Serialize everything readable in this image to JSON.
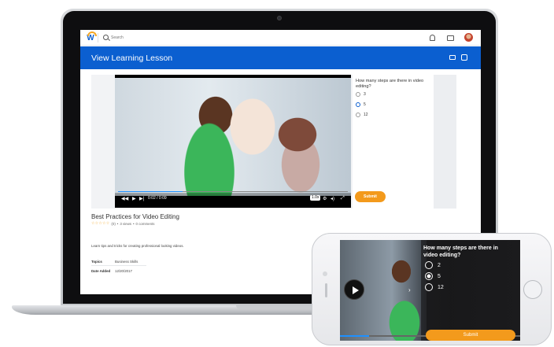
{
  "topbar": {
    "search_placeholder": "Search"
  },
  "header": {
    "title": "View Learning Lesson"
  },
  "video": {
    "time": "0:02 / 0:09",
    "speed": "1.0x",
    "progress_fraction": 0.28
  },
  "quiz": {
    "question": "How many steps are there in video editing?",
    "options": [
      {
        "label": "3",
        "selected": false
      },
      {
        "label": "5",
        "selected": true
      },
      {
        "label": "12",
        "selected": false
      }
    ],
    "submit_label": "Submit"
  },
  "lesson": {
    "title": "Best Practices for Video Editing",
    "stars": "☆☆☆☆☆",
    "rating_count": "(0)",
    "separator": "•",
    "views": "3 views",
    "comments": "0 comments",
    "description": "Learn tips and tricks for creating professional looking videos.",
    "details": [
      {
        "label": "Topics",
        "value": "Business Skills"
      },
      {
        "label": "Date Added",
        "value": "12/20/2017"
      }
    ]
  },
  "phone": {
    "question": "How many steps are there in video editing?",
    "options": [
      {
        "label": "2",
        "selected": false
      },
      {
        "label": "5",
        "selected": true
      },
      {
        "label": "12",
        "selected": false
      }
    ],
    "submit_label": "Submit",
    "progress_fraction": 0.16
  },
  "colors": {
    "brand_blue": "#0b5fd0",
    "accent_orange": "#f39a1c",
    "stars": "#f5a623"
  }
}
